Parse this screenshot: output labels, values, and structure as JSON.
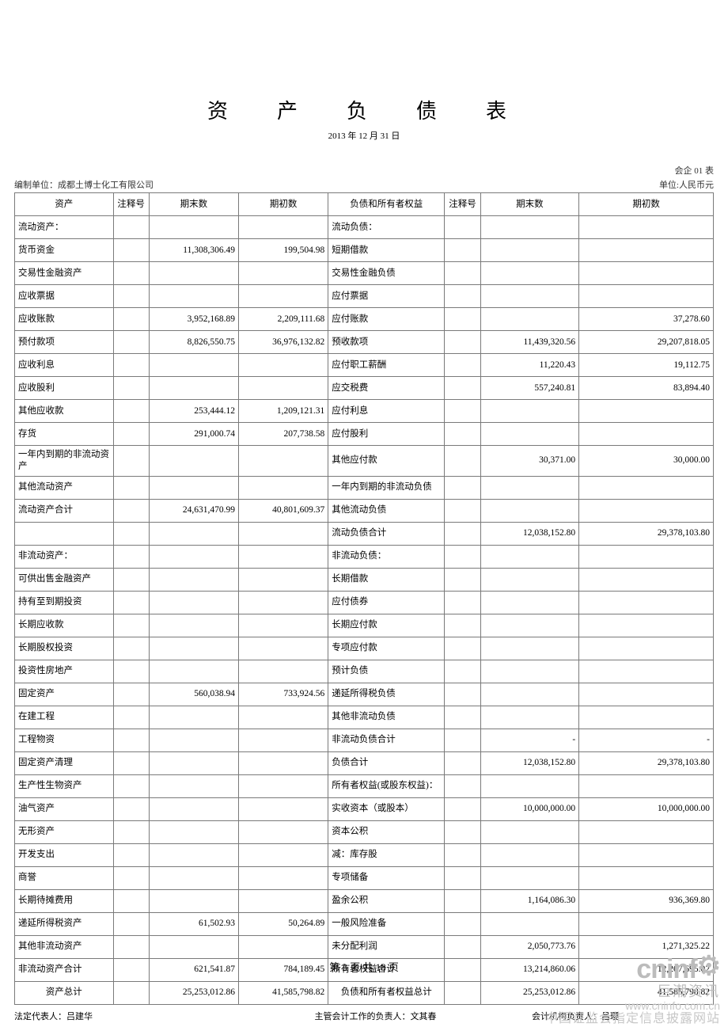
{
  "title": "资　产　负　债　表",
  "date": "2013 年 12 月 31 日",
  "form_id": "会企 01 表",
  "prep_unit": "编制单位：成都土博士化工有限公司",
  "currency_unit": "单位:人民币元",
  "headers": {
    "asset": "资产",
    "note": "注释号",
    "end": "期末数",
    "begin": "期初数",
    "liab": "负债和所有者权益",
    "note2": "注释号",
    "end2": "期末数",
    "begin2": "期初数"
  },
  "rows": [
    {
      "a": "流动资产：",
      "ae": "",
      "ab": "",
      "l": "流动负债：",
      "le": "",
      "lb": ""
    },
    {
      "a": "货币资金",
      "ae": "11,308,306.49",
      "ab": "199,504.98",
      "l": "短期借款",
      "le": "",
      "lb": ""
    },
    {
      "a": "交易性金融资产",
      "ae": "",
      "ab": "",
      "l": "交易性金融负债",
      "le": "",
      "lb": ""
    },
    {
      "a": "应收票据",
      "ae": "",
      "ab": "",
      "l": "应付票据",
      "le": "",
      "lb": ""
    },
    {
      "a": "应收账款",
      "ae": "3,952,168.89",
      "ab": "2,209,111.68",
      "l": "应付账款",
      "le": "",
      "lb": "37,278.60"
    },
    {
      "a": "预付款项",
      "ae": "8,826,550.75",
      "ab": "36,976,132.82",
      "l": "预收款项",
      "le": "11,439,320.56",
      "lb": "29,207,818.05"
    },
    {
      "a": "应收利息",
      "ae": "",
      "ab": "",
      "l": "应付职工薪酬",
      "le": "11,220.43",
      "lb": "19,112.75"
    },
    {
      "a": "应收股利",
      "ae": "",
      "ab": "",
      "l": "应交税费",
      "le": "557,240.81",
      "lb": "83,894.40"
    },
    {
      "a": "其他应收款",
      "ae": "253,444.12",
      "ab": "1,209,121.31",
      "l": "应付利息",
      "le": "",
      "lb": ""
    },
    {
      "a": "存货",
      "ae": "291,000.74",
      "ab": "207,738.58",
      "l": "应付股利",
      "le": "",
      "lb": ""
    },
    {
      "a": "一年内到期的非流动资产",
      "ae": "",
      "ab": "",
      "l": "其他应付款",
      "le": "30,371.00",
      "lb": "30,000.00"
    },
    {
      "a": "其他流动资产",
      "ae": "",
      "ab": "",
      "l": "一年内到期的非流动负债",
      "le": "",
      "lb": ""
    },
    {
      "a": "流动资产合计",
      "ae": "24,631,470.99",
      "ab": "40,801,609.37",
      "l": "其他流动负债",
      "le": "",
      "lb": ""
    },
    {
      "a": "",
      "ae": "",
      "ab": "",
      "l": "流动负债合计",
      "le": "12,038,152.80",
      "lb": "29,378,103.80"
    },
    {
      "a": "非流动资产：",
      "ae": "",
      "ab": "",
      "l": "非流动负债：",
      "le": "",
      "lb": ""
    },
    {
      "a": "可供出售金融资产",
      "ae": "",
      "ab": "",
      "l": "长期借款",
      "le": "",
      "lb": ""
    },
    {
      "a": "持有至到期投资",
      "ae": "",
      "ab": "",
      "l": "应付债券",
      "le": "",
      "lb": ""
    },
    {
      "a": "长期应收款",
      "ae": "",
      "ab": "",
      "l": "长期应付款",
      "le": "",
      "lb": ""
    },
    {
      "a": "长期股权投资",
      "ae": "",
      "ab": "",
      "l": "专项应付款",
      "le": "",
      "lb": ""
    },
    {
      "a": "投资性房地产",
      "ae": "",
      "ab": "",
      "l": "预计负债",
      "le": "",
      "lb": ""
    },
    {
      "a": "固定资产",
      "ae": "560,038.94",
      "ab": "733,924.56",
      "l": "递延所得税负债",
      "le": "",
      "lb": ""
    },
    {
      "a": "在建工程",
      "ae": "",
      "ab": "",
      "l": "其他非流动负债",
      "le": "",
      "lb": ""
    },
    {
      "a": "工程物资",
      "ae": "",
      "ab": "",
      "l": "非流动负债合计",
      "le": "-",
      "lb": "-"
    },
    {
      "a": "固定资产清理",
      "ae": "",
      "ab": "",
      "l": "负债合计",
      "le": "12,038,152.80",
      "lb": "29,378,103.80"
    },
    {
      "a": "生产性生物资产",
      "ae": "",
      "ab": "",
      "l": "所有者权益(或股东权益)：",
      "le": "",
      "lb": ""
    },
    {
      "a": "油气资产",
      "ae": "",
      "ab": "",
      "l": "实收资本（或股本）",
      "le": "10,000,000.00",
      "lb": "10,000,000.00"
    },
    {
      "a": "无形资产",
      "ae": "",
      "ab": "",
      "l": "资本公积",
      "le": "",
      "lb": ""
    },
    {
      "a": "开发支出",
      "ae": "",
      "ab": "",
      "l": "减：库存股",
      "le": "",
      "lb": ""
    },
    {
      "a": "商誉",
      "ae": "",
      "ab": "",
      "l": "专项储备",
      "le": "",
      "lb": ""
    },
    {
      "a": "长期待摊费用",
      "ae": "",
      "ab": "",
      "l": "盈余公积",
      "le": "1,164,086.30",
      "lb": "936,369.80"
    },
    {
      "a": "递延所得税资产",
      "ae": "61,502.93",
      "ab": "50,264.89",
      "l": "一般风险准备",
      "le": "",
      "lb": ""
    },
    {
      "a": "其他非流动资产",
      "ae": "",
      "ab": "",
      "l": "未分配利润",
      "le": "2,050,773.76",
      "lb": "1,271,325.22"
    },
    {
      "a": "非流动资产合计",
      "ae": "621,541.87",
      "ab": "784,189.45",
      "l": "所有者权益合计",
      "le": "13,214,860.06",
      "lb": "12,207,695.02"
    }
  ],
  "total_row": {
    "a": "资产总计",
    "ae": "25,253,012.86",
    "ab": "41,585,798.82",
    "l": "负债和所有者权益总计",
    "le": "25,253,012.86",
    "lb": "41,585,798.82"
  },
  "signatures": {
    "legal_rep": "法定代表人：吕建华",
    "chief_acc": "主管会计工作的负责人：文其春",
    "acc_org": "会计机构负责人：吕璎"
  },
  "page_number": "第 3 页 共 18 页",
  "watermark": {
    "brand": "cninf",
    "cn": "巨潮资讯",
    "url": "www.cninfo.com.cn",
    "desc": "中国证监会指定信息披露网站"
  }
}
